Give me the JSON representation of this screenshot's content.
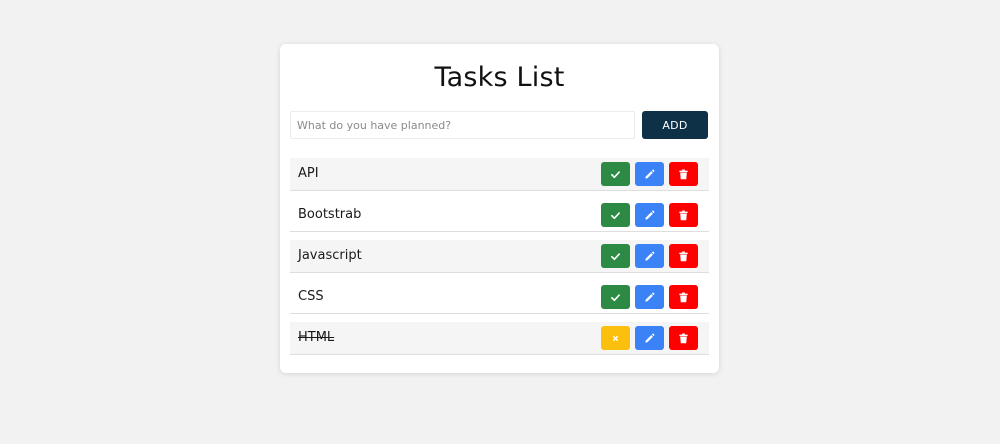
{
  "title": "Tasks List",
  "input": {
    "value": "",
    "placeholder": "What do you have planned?"
  },
  "add_label": "ADD",
  "tasks": [
    {
      "text": "API",
      "completed": false
    },
    {
      "text": "Bootstrab",
      "completed": false
    },
    {
      "text": "Javascript",
      "completed": false
    },
    {
      "text": "CSS",
      "completed": false
    },
    {
      "text": "HTML",
      "completed": true
    }
  ],
  "icons": {
    "complete": "check-icon",
    "undo": "x-icon",
    "edit": "pencil-icon",
    "delete": "trash-icon"
  },
  "colors": {
    "page_background": "#f2f2f2",
    "add_button": "#0f3147",
    "complete_button": "#2c8a45",
    "undo_button": "#fbbf0d",
    "edit_button": "#3b82f6",
    "delete_button": "#ff0000",
    "shaded_row": "#f5f5f5"
  }
}
